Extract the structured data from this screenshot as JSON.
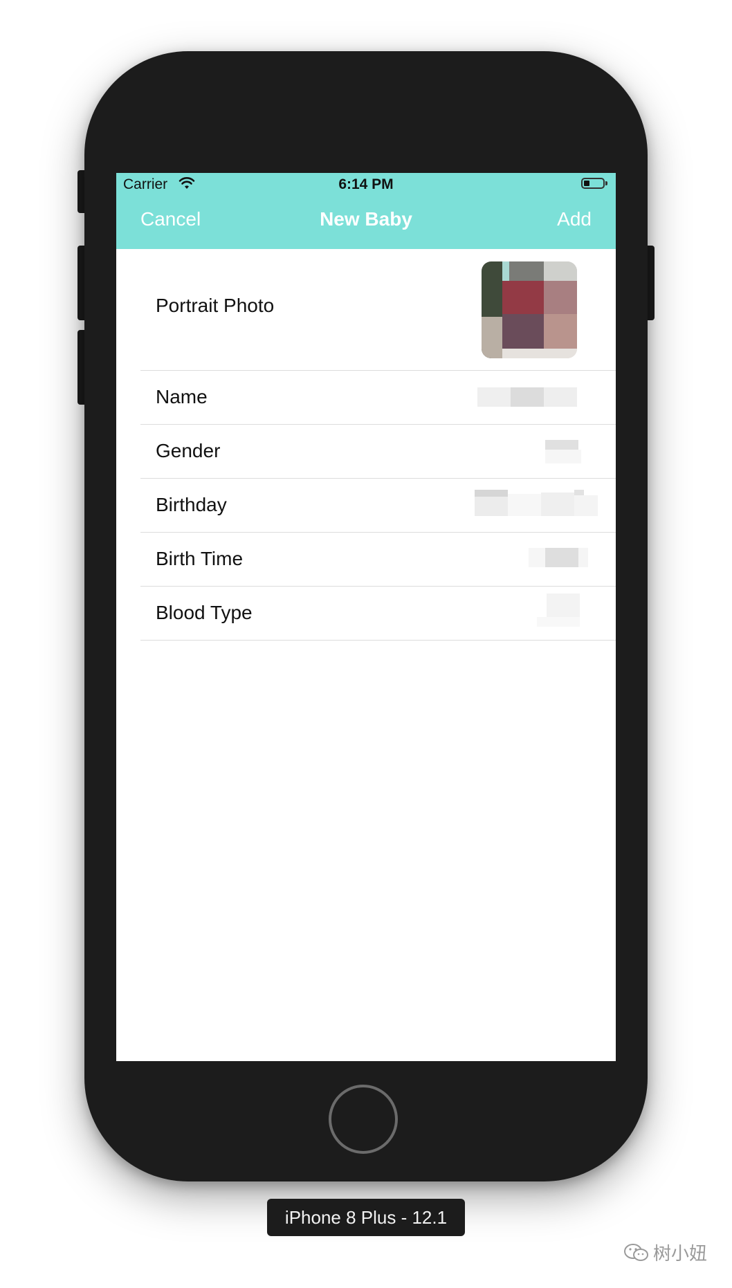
{
  "status_bar": {
    "carrier": "Carrier",
    "time": "6:14 PM",
    "battery_level": 0.3
  },
  "nav": {
    "left_button": "Cancel",
    "title": "New Baby",
    "right_button": "Add",
    "background_color": "#7ce0d8"
  },
  "form": {
    "rows": [
      {
        "label": "Portrait Photo"
      },
      {
        "label": "Name"
      },
      {
        "label": "Gender"
      },
      {
        "label": "Birthday"
      },
      {
        "label": "Birth Time"
      },
      {
        "label": "Blood Type"
      }
    ]
  },
  "device_label": "iPhone 8 Plus - 12.1",
  "watermark": "树小妞",
  "icons": [
    "wifi-icon",
    "battery-icon",
    "home-button",
    "wechat-icon"
  ]
}
